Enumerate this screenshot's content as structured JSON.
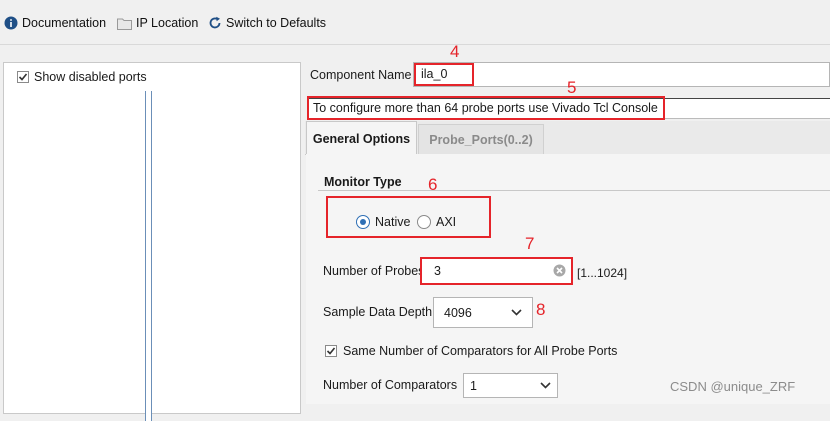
{
  "toolbar": {
    "documentation": "Documentation",
    "ip_location": "IP Location",
    "switch_defaults": "Switch to Defaults"
  },
  "left_panel": {
    "show_disabled_ports": "Show disabled ports"
  },
  "component": {
    "label": "Component Name",
    "value": "ila_0"
  },
  "notice": "To configure more than 64 probe ports use Vivado Tcl Console",
  "tabs": [
    "General Options",
    "Probe_Ports(0..2)"
  ],
  "monitor": {
    "title": "Monitor Type",
    "native": "Native",
    "axi": "AXI",
    "selected": "Native"
  },
  "probes": {
    "label": "Number of Probes",
    "value": "3",
    "range": "[1...1024]"
  },
  "depth": {
    "label": "Sample Data Depth",
    "value": "4096"
  },
  "same_comparators": "Same Number of Comparators for All Probe Ports",
  "comparators": {
    "label": "Number of Comparators",
    "value": "1"
  },
  "annotations": [
    "4",
    "5",
    "6",
    "7",
    "8"
  ],
  "watermark": "CSDN @unique_ZRF",
  "colors": {
    "annotation_red": "#e5242a",
    "radio_blue": "#2f6fb5"
  }
}
